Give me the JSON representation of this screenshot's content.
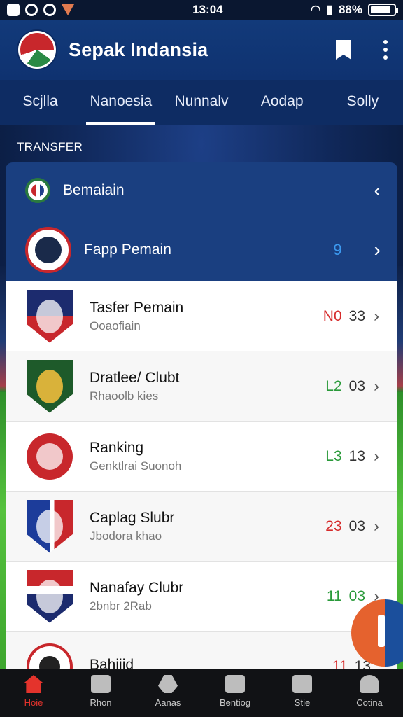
{
  "status_bar": {
    "time": "13:04",
    "battery": "88%"
  },
  "app_bar": {
    "title": "Sepak Indansia"
  },
  "tabs": [
    {
      "label": "Scjlla",
      "active": false
    },
    {
      "label": "Nanoesia",
      "active": true
    },
    {
      "label": "Nunnalv",
      "active": false
    },
    {
      "label": "Aodap",
      "active": false
    },
    {
      "label": "Solly",
      "active": false
    }
  ],
  "section_label": "TRANSFER",
  "card_header": {
    "row1": {
      "label": "Bemaiain"
    },
    "row2": {
      "label": "Fapp Pemain",
      "value": "9"
    }
  },
  "list": [
    {
      "title": "Tasfer Pemain",
      "subtitle": "Ooaofiain",
      "score": "N0",
      "score_color": "red",
      "rank": "33"
    },
    {
      "title": "Dratlee/ Clubt",
      "subtitle": "Rhaoolb kies",
      "score": "L2",
      "score_color": "green",
      "rank": "03"
    },
    {
      "title": "Ranking",
      "subtitle": "Genktlrai Suonoh",
      "score": "L3",
      "score_color": "green",
      "rank": "13"
    },
    {
      "title": "Caplag Slubr",
      "subtitle": "Jbodora khao",
      "score": "23",
      "score_color": "red",
      "rank": "03"
    },
    {
      "title": "Nanafay Clubr",
      "subtitle": "2bnbr 2Rab",
      "score": "11",
      "score_color": "green",
      "rank": "03"
    },
    {
      "title": "Bahiiid",
      "subtitle": "",
      "score": "11",
      "score_color": "red",
      "rank": "13"
    }
  ],
  "bottom_nav": [
    {
      "label": "Hoie",
      "active": true
    },
    {
      "label": "Rhon",
      "active": false
    },
    {
      "label": "Aanas",
      "active": false
    },
    {
      "label": "Bentiog",
      "active": false
    },
    {
      "label": "Stie",
      "active": false
    },
    {
      "label": "Cotina",
      "active": false
    }
  ],
  "colors": {
    "accent_red": "#e4332c",
    "primary_blue": "#123a7a",
    "score_red": "#d62b2b",
    "score_green": "#2a9a3a"
  }
}
